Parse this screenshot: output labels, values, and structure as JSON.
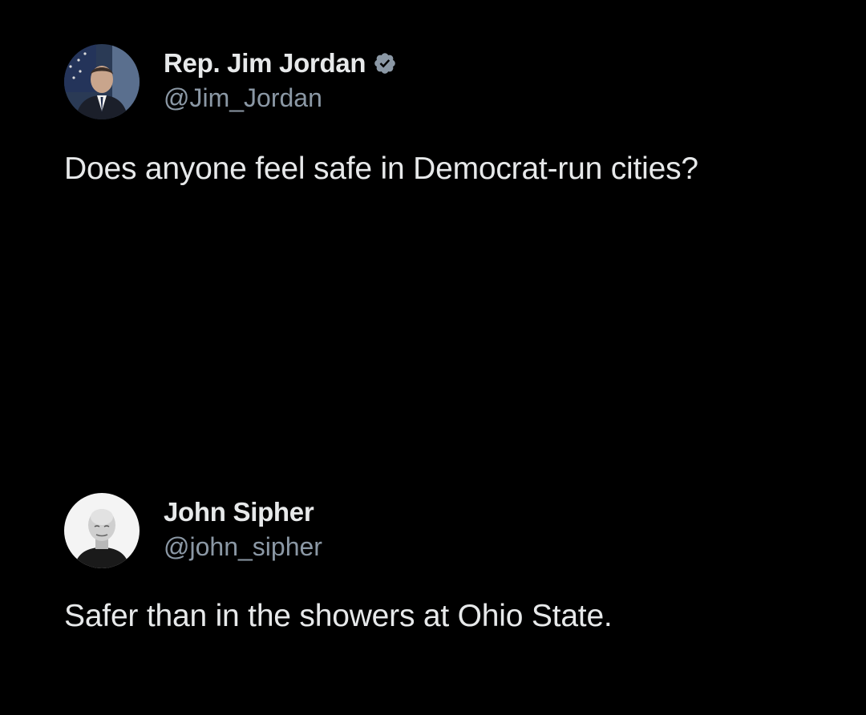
{
  "posts": [
    {
      "author": {
        "display_name": "Rep. Jim Jordan",
        "handle": "@Jim_Jordan",
        "verified": true
      },
      "text": "Does anyone feel safe in Democrat-run cities?"
    },
    {
      "author": {
        "display_name": "John Sipher",
        "handle": "@john_sipher",
        "verified": false
      },
      "text": "Safer than in the showers at Ohio State."
    }
  ],
  "colors": {
    "background": "#000000",
    "primary_text": "#e7e9ea",
    "secondary_text": "#8b98a5",
    "verified_badge": "#8b98a5"
  },
  "icons": {
    "verified": "verified-badge-icon"
  }
}
